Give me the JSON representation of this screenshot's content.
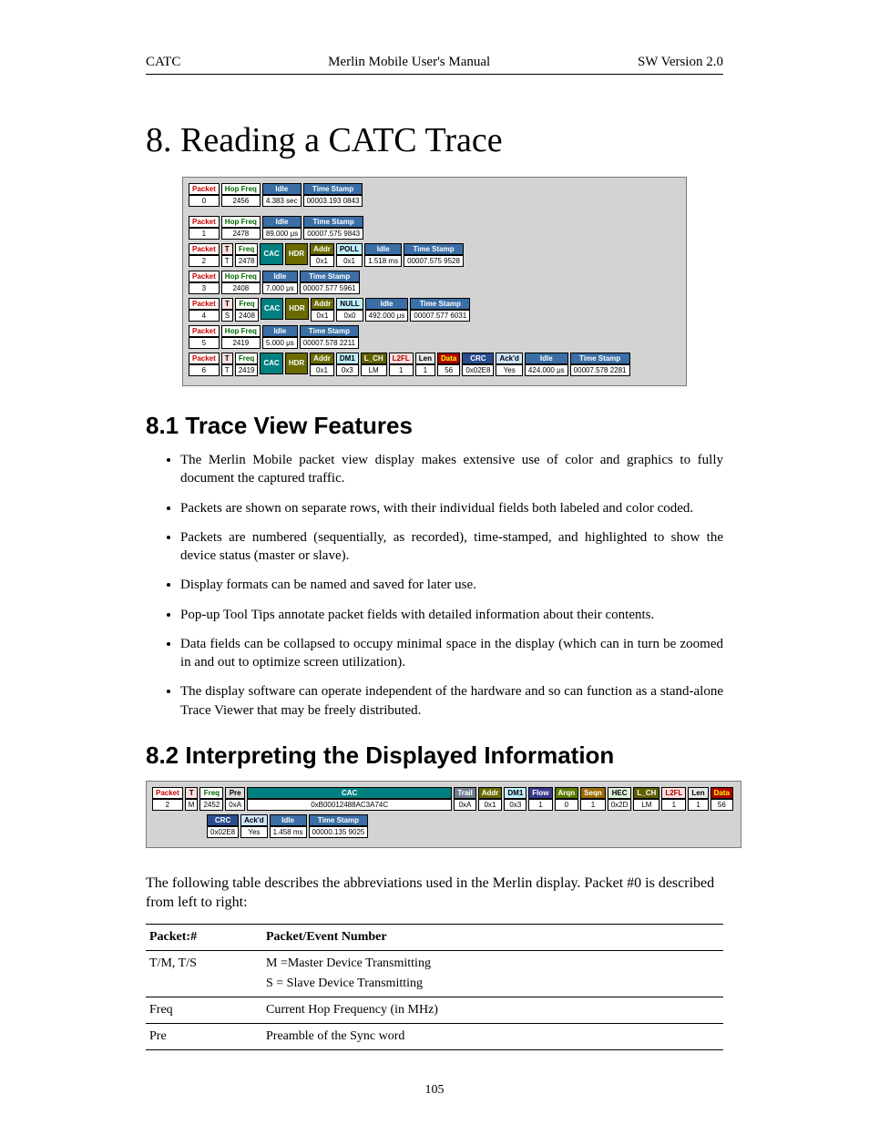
{
  "header": {
    "left": "CATC",
    "center": "Merlin Mobile User's Manual",
    "right": "SW Version 2.0"
  },
  "chapter": "8.  Reading a CATC Trace",
  "section81": "8.1  Trace View Features",
  "bullets": [
    "The Merlin Mobile packet view display makes extensive use of color and graphics to fully document the captured traffic.",
    "Packets are shown on separate rows, with their individual fields both labeled and color coded.",
    "Packets are numbered (sequentially, as recorded), time-stamped, and highlighted to show the device status (master or slave).",
    "Display formats can be named and saved for later use.",
    "Pop-up Tool Tips annotate packet fields with detailed information about their contents.",
    "Data fields can be collapsed to occupy minimal space in the display (which can in turn be zoomed in and out to optimize screen utilization).",
    "The display software can operate independent of the hardware and so can function as a stand-alone Trace Viewer that may be freely distributed."
  ],
  "section82": "8.2  Interpreting the Displayed Information",
  "para82": "The following table describes the abbreviations used in the Merlin display. Packet #0 is described from left to right:",
  "abbrev": {
    "h1": "Packet:#",
    "h2": "Packet/Event Number",
    "r": [
      {
        "k": "T/M, T/S",
        "v": [
          "M =Master Device Transmitting",
          "S = Slave Device Transmitting"
        ]
      },
      {
        "k": "Freq",
        "v": [
          "Current Hop Frequency (in MHz)"
        ]
      },
      {
        "k": "Pre",
        "v": [
          "Preamble of the Sync word"
        ]
      }
    ]
  },
  "fig1": {
    "labels": {
      "packet": "Packet",
      "hopfreq": "Hop Freq",
      "idle": "Idle",
      "ts": "Time Stamp",
      "freq": "Freq",
      "cac": "CAC",
      "hdr": "HDR",
      "addr": "Addr",
      "type_poll": "POLL",
      "type_null": "NULL",
      "type_dm1": "DM1",
      "crc": "CRC",
      "ackd": "Ack'd",
      "lch": "L_CH",
      "l2fl": "L2FL",
      "len": "Len",
      "data": "Data",
      "t": "T",
      "s": "S",
      "m": "M"
    },
    "rows": [
      {
        "n": "0",
        "hop": "2456",
        "idle": "4.383 sec",
        "ts": "00003.193 0843"
      },
      {
        "n": "1",
        "hop": "2478",
        "idle": "89.000 μs",
        "ts": "00007.575 9843"
      },
      {
        "n": "2",
        "tm": "T",
        "freq": "2478",
        "addr": "0x1",
        "type": "POLL",
        "ptv": "0x1",
        "idle": "1.518 ms",
        "ts": "00007.575 9528"
      },
      {
        "n": "3",
        "hop": "2408",
        "idle": "7.000 μs",
        "ts": "00007.577 5961"
      },
      {
        "n": "4",
        "tm": "S",
        "freq": "2408",
        "addr": "0x1",
        "type": "NULL",
        "ptv": "0x0",
        "idle": "492.000 μs",
        "ts": "00007.577 6031"
      },
      {
        "n": "5",
        "hop": "2419",
        "idle": "5.000 μs",
        "ts": "00007.578 2211"
      },
      {
        "n": "6",
        "tm": "T",
        "freq": "2419",
        "addr": "0x1",
        "type": "DM1",
        "ptv": "0x3",
        "lch": "LM",
        "l2fl": "1",
        "len": "1",
        "dlen": "56",
        "crc": "0x02E8",
        "ackd": "Yes",
        "idle": "424.000 μs",
        "ts": "00007.578 2281"
      }
    ]
  },
  "fig2": {
    "labels": {
      "packet": "Packet",
      "t": "T",
      "m": "M",
      "freq": "Freq",
      "pre": "Pre",
      "cac": "CAC",
      "trail": "Trail",
      "addr": "Addr",
      "dm1": "DM1",
      "flow": "Flow",
      "arqn": "Arqn",
      "seqn": "Seqn",
      "hec": "HEC",
      "lch": "L_CH",
      "l2fl": "L2FL",
      "len": "Len",
      "data": "Data",
      "crc": "CRC",
      "ackd": "Ack'd",
      "idle": "Idle",
      "ts": "Time Stamp"
    },
    "r1": {
      "n": "2",
      "tm": "M",
      "freq": "2452",
      "pre": "0xA",
      "cac": "0xB00012488AC3A74C",
      "trail": "0xA",
      "addr": "0x1",
      "dm1": "0x3",
      "flow": "1",
      "arqn": "0",
      "seqn": "1",
      "hec": "0x2D",
      "lch": "LM",
      "l2fl": "1",
      "len": "1",
      "data": "56"
    },
    "r2": {
      "crc": "0x02E8",
      "ackd": "Yes",
      "idle": "1.458 ms",
      "ts": "00000.135 9025"
    }
  },
  "page_num": "105"
}
